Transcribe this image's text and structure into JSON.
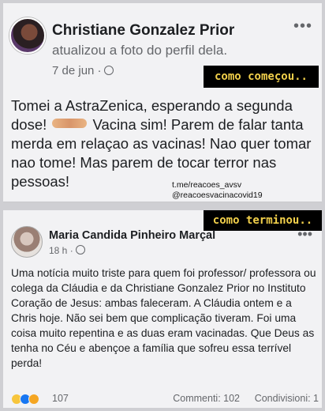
{
  "post1": {
    "author": "Christiane Gonzalez Prior",
    "action": "atualizou a foto do perfil dela.",
    "date": "7 de jun ·",
    "more": "•••",
    "overlay": "como começou..",
    "text_a": "Tomei a AstraZenica, esperando a segunda dose!",
    "text_b": "Vacina sim! Parem de falar tanta merda em relaçao as vacinas! Nao quer tomar nao tome! Mas parem de tocar terror nas pessoas!",
    "watermark_1": "t.me/reacoes_avsv",
    "watermark_2": "@reacoesvacinacovid19"
  },
  "post2": {
    "overlay": "como terminou..",
    "author": "Maria Candida Pinheiro Marçal",
    "date": "18 h ·",
    "more": "•••",
    "text": "Uma notícia muito triste para quem foi professor/ professora ou colega da Cláudia e da Christiane Gonzalez Prior no Instituto Coração de Jesus: ambas faleceram. A Cláudia ontem e a Chris hoje. Não sei bem que complicação tiveram. Foi uma coisa muito repentina e as duas eram vacinadas. Que Deus as tenha no Céu e abençoe a família que sofreu essa terrível perda!",
    "reaction_count": "107",
    "comments": "Commenti: 102",
    "shares": "Condivisioni: 1"
  }
}
